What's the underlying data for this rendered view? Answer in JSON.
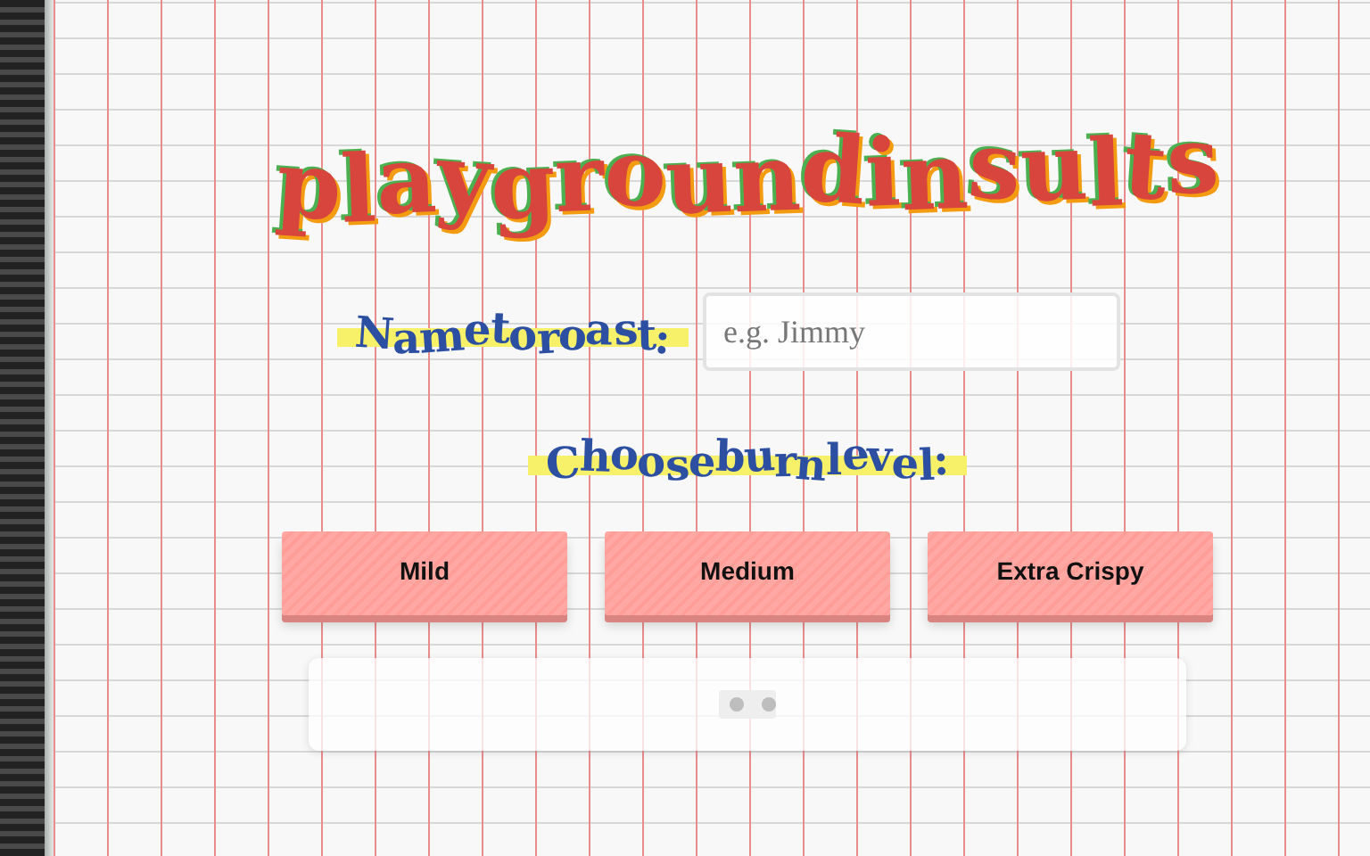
{
  "title": "playgroundinsults",
  "name_field": {
    "label": "Nametoroast:",
    "placeholder": "e.g. Jimmy"
  },
  "burn_level": {
    "label": "Chooseburnlevel:"
  },
  "buttons": [
    {
      "label": "Mild"
    },
    {
      "label": "Medium"
    },
    {
      "label": "Extra Crispy"
    }
  ],
  "output": {
    "loading": true
  }
}
